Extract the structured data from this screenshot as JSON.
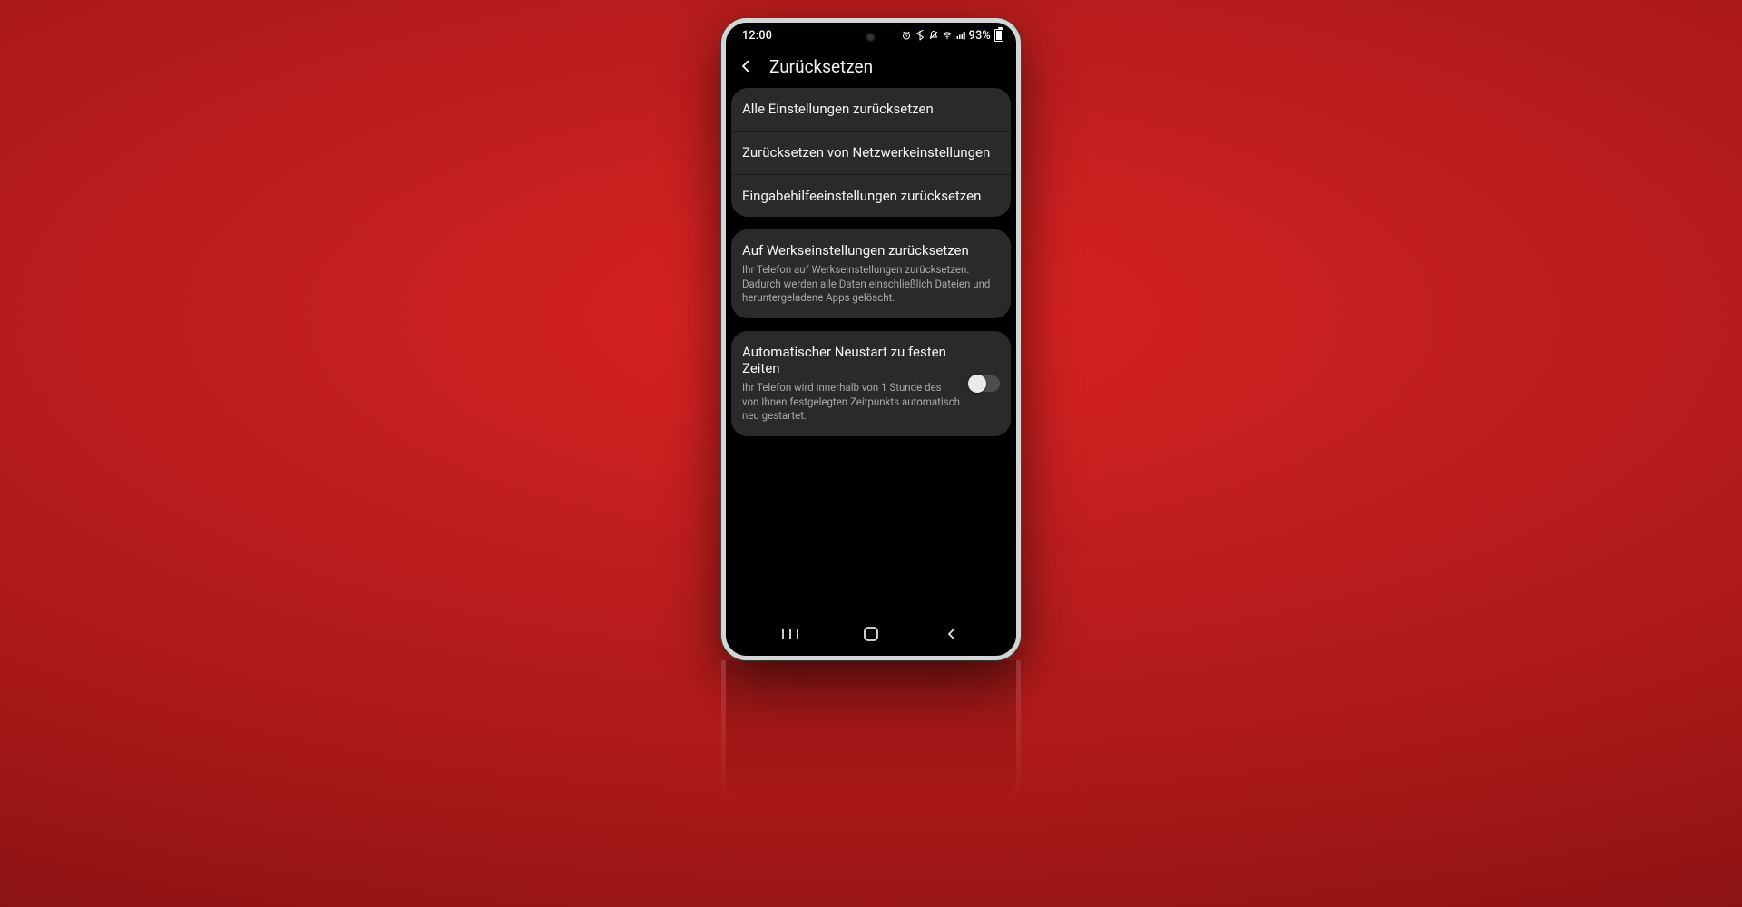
{
  "statusbar": {
    "time": "12:00",
    "battery_percent": "93%"
  },
  "header": {
    "title": "Zurücksetzen"
  },
  "group1": {
    "items": [
      {
        "title": "Alle Einstellungen zurücksetzen"
      },
      {
        "title": "Zurücksetzen von Netzwerkeinstellungen"
      },
      {
        "title": "Eingabehilfeeinstellungen zurücksetzen"
      }
    ]
  },
  "group2": {
    "title": "Auf Werkseinstellungen zurücksetzen",
    "subtitle": "Ihr Telefon auf Werkseinstellungen zurücksetzen. Dadurch werden alle Daten einschließlich Dateien und heruntergeladene Apps gelöscht."
  },
  "group3": {
    "title": "Automatischer Neustart zu festen Zeiten",
    "subtitle": "Ihr Telefon wird innerhalb von 1 Stunde des von Ihnen festgelegten Zeitpunkts automatisch neu gestartet.",
    "toggle_on": false
  }
}
